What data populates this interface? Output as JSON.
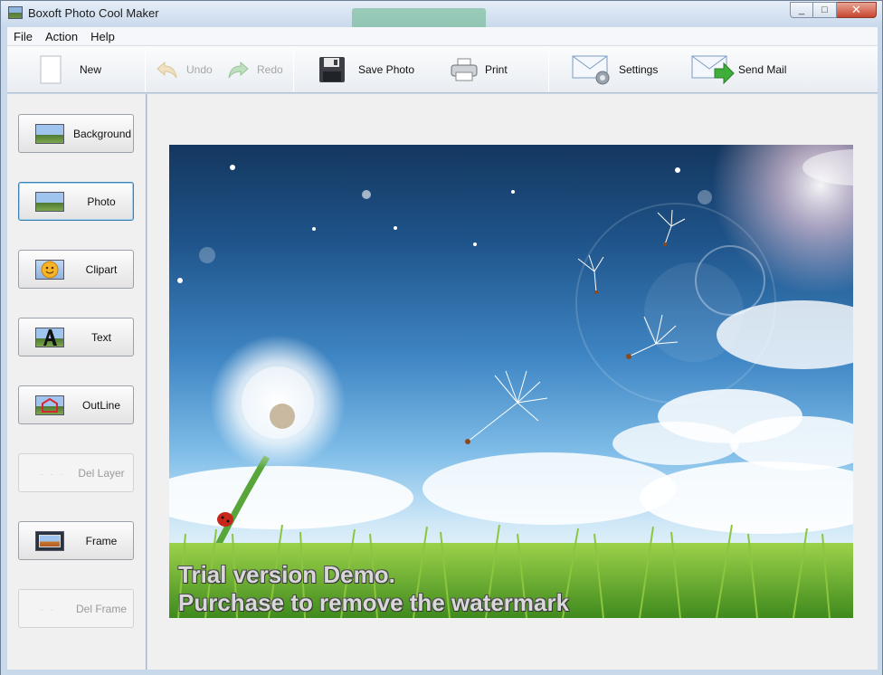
{
  "window": {
    "title": "Boxoft Photo Cool Maker"
  },
  "caption": {
    "minimize": "_",
    "maximize": "□",
    "close": "✕"
  },
  "menu": [
    "File",
    "Action",
    "Help"
  ],
  "toolbar": {
    "new_label": "New",
    "undo_label": "Undo",
    "redo_label": "Redo",
    "save_label": "Save Photo",
    "print_label": "Print",
    "settings_label": "Settings",
    "sendmail_label": "Send Mail"
  },
  "sidebar": {
    "items": [
      {
        "label": "Background",
        "icon": "landscape-icon"
      },
      {
        "label": "Photo",
        "icon": "landscape-icon",
        "active": true
      },
      {
        "label": "Clipart",
        "icon": "smiley-icon"
      },
      {
        "label": "Text",
        "icon": "letter-a-icon"
      },
      {
        "label": "OutLine",
        "icon": "outline-shape-icon"
      },
      {
        "label": "Del Layer",
        "disabled": true
      },
      {
        "label": "Frame",
        "icon": "frame-icon"
      },
      {
        "label": "Del Frame",
        "disabled": true
      }
    ]
  },
  "canvas": {
    "watermark_line1": "Trial version Demo.",
    "watermark_line2": "Purchase to remove the watermark"
  },
  "colors": {
    "sky_top": "#14375f",
    "sky_mid": "#3f86c4",
    "grass": "#6fae2f",
    "accent_active": "#3c7fb1"
  }
}
